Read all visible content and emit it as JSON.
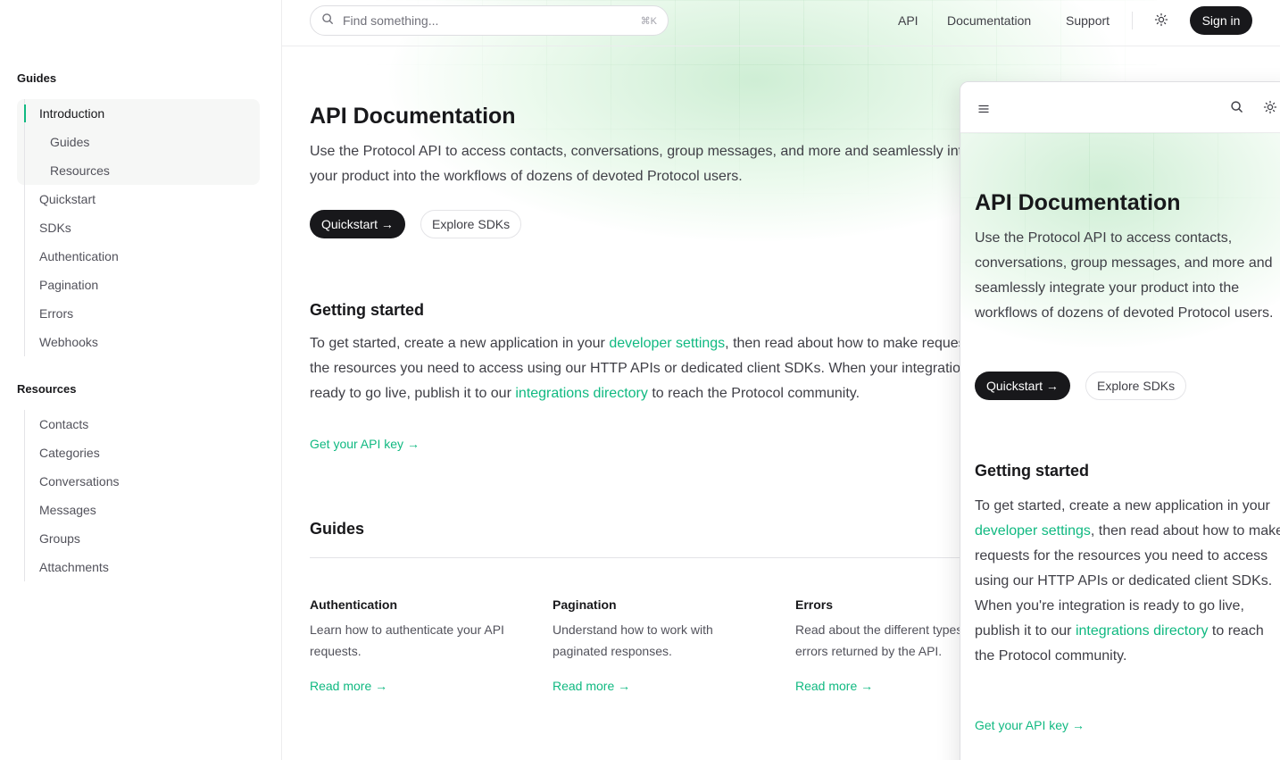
{
  "sidebar": {
    "groups": [
      {
        "title": "Guides",
        "items": [
          {
            "label": "Introduction",
            "active": true
          },
          {
            "label": "Guides",
            "sub": true
          },
          {
            "label": "Resources",
            "sub": true
          },
          {
            "label": "Quickstart"
          },
          {
            "label": "SDKs"
          },
          {
            "label": "Authentication"
          },
          {
            "label": "Pagination"
          },
          {
            "label": "Errors"
          },
          {
            "label": "Webhooks"
          }
        ]
      },
      {
        "title": "Resources",
        "items": [
          {
            "label": "Contacts"
          },
          {
            "label": "Categories"
          },
          {
            "label": "Conversations"
          },
          {
            "label": "Messages"
          },
          {
            "label": "Groups"
          },
          {
            "label": "Attachments"
          }
        ]
      }
    ]
  },
  "header": {
    "search_placeholder": "Find something...",
    "search_shortcut": "⌘K",
    "links": [
      "API",
      "Documentation",
      "Support"
    ],
    "signin_label": "Sign in"
  },
  "main": {
    "title": "API Documentation",
    "lead_line1": "Use the Protocol API to access contacts, conversations, group messages, and more and seamlessly integrate",
    "lead_line2": "your product into the workflows of dozens of devoted Protocol users.",
    "quickstart_label": "Quickstart →",
    "explore_label": "Explore SDKs",
    "getting_started": {
      "title": "Getting started",
      "line1_pre": "To get started, create a new application in your ",
      "line1_link": "developer settings",
      "line1_post": ", then read about how to make requests for",
      "line2": "the resources you need to access using our HTTP APIs or dedicated client SDKs. When your integration is",
      "line3_pre": "ready to go live, publish it to our ",
      "line3_link": "integrations directory",
      "line3_post": " to reach the Protocol community.",
      "cta": "Get your API key →"
    },
    "guides": {
      "title": "Guides",
      "cards": [
        {
          "title": "Authentication",
          "desc": "Learn how to authenticate your API requests.",
          "link": "Read more →"
        },
        {
          "title": "Pagination",
          "desc": "Understand how to work with paginated responses.",
          "link": "Read more →"
        },
        {
          "title": "Errors",
          "desc": "Read about the different types of errors returned by the API.",
          "link": "Read more →"
        }
      ]
    }
  },
  "mobile": {
    "title": "API Documentation",
    "lead": "Use the Protocol API to access contacts, conversations, group messages, and more and seamlessly integrate your product into the workflows of dozens of devoted Protocol users.",
    "quickstart_label": "Quickstart →",
    "explore_label": "Explore SDKs",
    "gs_title": "Getting started",
    "gs_pre": "To get started, create a new application in your ",
    "gs_link1": "developer settings",
    "gs_mid": ", then read about how to make requests for the resources you need to access using our HTTP APIs or dedicated client SDKs. When you're integration is ready to go live, publish it to our ",
    "gs_link2": "integrations directory",
    "gs_post": " to reach the Protocol community.",
    "cta": "Get your API key →"
  },
  "colors": {
    "accent": "#10b981",
    "dark": "#18181b",
    "text": "#3f3f46"
  }
}
